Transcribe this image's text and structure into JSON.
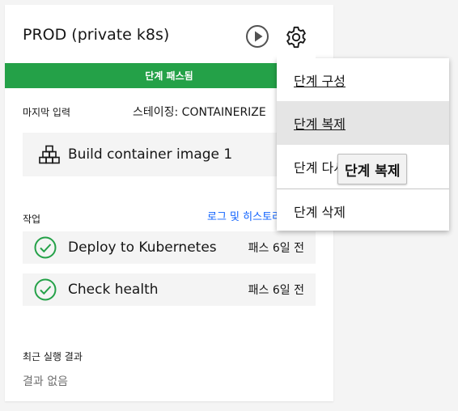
{
  "card": {
    "title": "PROD (private k8s)",
    "status": "단계 패스됨",
    "status_color": "#24a148",
    "last_input_label": "마지막 입력",
    "staging": "스테이징: CONTAINERIZE",
    "input_name": "Build container image 1",
    "input_icon": "stack-boxes-icon",
    "jobs_label": "작업",
    "log_link": "로그 및 히스토리",
    "jobs": [
      {
        "name": "Deploy to Kubernetes",
        "meta": "패스 6일 전",
        "icon": "check-circle-icon"
      },
      {
        "name": "Check health",
        "meta": "패스 6일 전",
        "icon": "check-circle-icon"
      }
    ],
    "recent_label": "최근 실행 결과",
    "recent_value": "결과 없음"
  },
  "toolbar": {
    "run_icon": "play-icon",
    "settings_icon": "gear-icon"
  },
  "menu": {
    "items": [
      {
        "label": "단계 구성"
      },
      {
        "label": "단계 복제"
      },
      {
        "label": "단계 다시 실행"
      },
      {
        "label": "단계 삭제"
      }
    ]
  },
  "tooltip": {
    "text": "단계 복제"
  }
}
